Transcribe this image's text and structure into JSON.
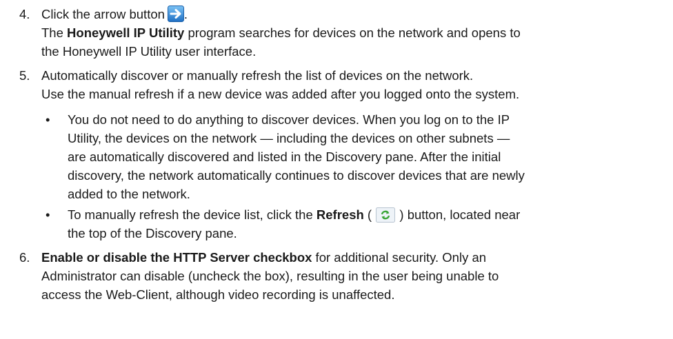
{
  "colors": {
    "text": "#1a1a1a",
    "arrow_icon_bg": "#3b8fd9",
    "refresh_icon_green": "#3aa536"
  },
  "step4": {
    "number": "4.",
    "line1_prefix": "Click the arrow button",
    "line1_suffix": ".",
    "arrow_icon": "arrow-right-icon",
    "line2_pre": "The ",
    "line2_bold": "Honeywell IP Utility",
    "line2_post": " program searches for devices on the network and opens to",
    "line3": "the Honeywell IP Utility user interface."
  },
  "step5": {
    "number": "5.",
    "line1": "Automatically discover or manually refresh the list of devices on the network.",
    "line2": "Use the manual refresh if a new device was added after you logged onto the system.",
    "bullets": [
      {
        "symbol": "•",
        "lines": [
          "You do not need to do anything to discover devices. When you log on to the IP",
          "Utility, the devices on the network — including the devices on other subnets —",
          "are automatically discovered and listed in the Discovery pane. After the initial",
          "discovery, the network automatically continues to discover devices that are newly",
          "added to the network."
        ]
      },
      {
        "symbol": "•",
        "line1_pre": "To manually refresh the device list, click the ",
        "line1_bold": "Refresh",
        "line1_paren_open": " ( ",
        "refresh_icon": "refresh-icon",
        "line1_paren_close": " ) button, located near",
        "line2": "the top of the Discovery pane."
      }
    ]
  },
  "step6": {
    "number": "6.",
    "line1_bold": "Enable or disable the HTTP Server checkbox",
    "line1_post": " for additional security. Only an",
    "line2": "Administrator can disable (uncheck the box), resulting in the user being unable to",
    "line3": "access the Web-Client, although video recording is unaffected."
  }
}
